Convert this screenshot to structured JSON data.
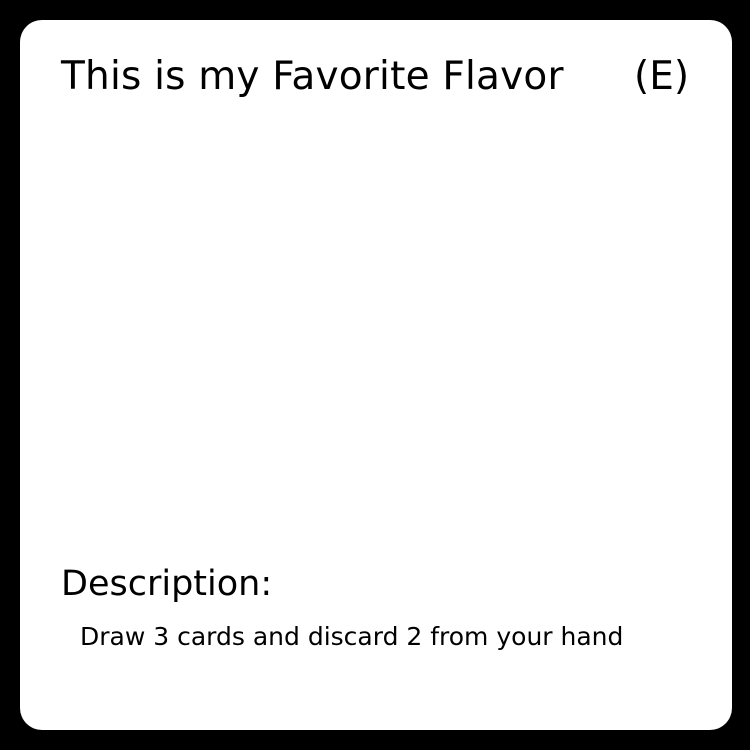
{
  "card": {
    "title": "This is my Favorite Flavor",
    "type_code": "(E)",
    "description_heading": "Description:",
    "description_text": "Draw 3 cards and discard 2 from your hand"
  },
  "colors": {
    "frame": "#000000",
    "card_background": "#ffffff",
    "text": "#000000"
  }
}
